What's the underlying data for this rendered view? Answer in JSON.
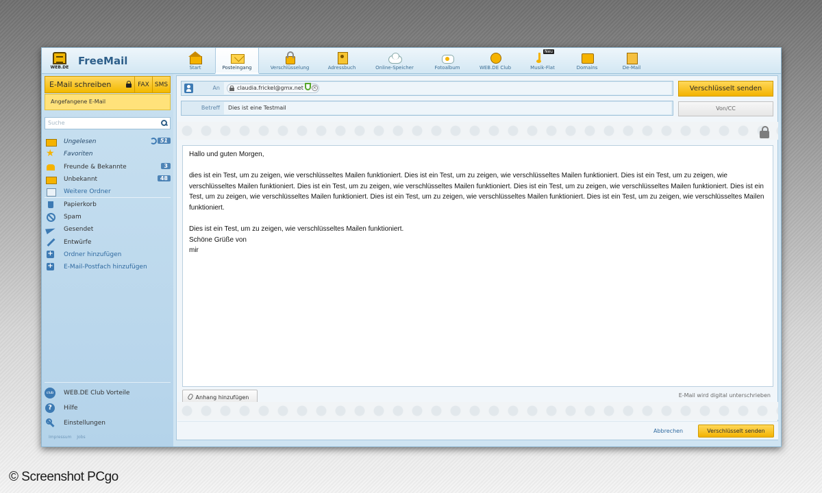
{
  "app": {
    "brand": "FreeMail",
    "logo_text": "WEB.DE"
  },
  "nav": [
    {
      "label": "Start",
      "icon": "home-icon"
    },
    {
      "label": "Posteingang",
      "icon": "mail-icon",
      "active": true
    },
    {
      "label": "Verschlüsselung",
      "icon": "lock-icon"
    },
    {
      "label": "Adressbuch",
      "icon": "addressbook-icon"
    },
    {
      "label": "Online-Speicher",
      "icon": "cloud-icon"
    },
    {
      "label": "Fotoalbum",
      "icon": "photo-icon"
    },
    {
      "label": "WEB.DE Club",
      "icon": "club-icon"
    },
    {
      "label": "Musik-Flat",
      "icon": "music-icon",
      "badge": "Neu"
    },
    {
      "label": "Domains",
      "icon": "domains-icon"
    },
    {
      "label": "De-Mail",
      "icon": "demail-icon"
    }
  ],
  "sidebar": {
    "compose_label": "E-Mail schreiben",
    "fax_label": "FAX",
    "sms_label": "SMS",
    "drafts_label": "Angefangene E-Mail",
    "search_placeholder": "Suche",
    "folders": [
      {
        "label": "Ungelesen",
        "badge": "51",
        "icon": "mail-icon"
      },
      {
        "label": "Favoriten",
        "icon": "star-icon"
      },
      {
        "label": "Freunde & Bekannte",
        "badge": "3",
        "icon": "people-icon"
      },
      {
        "label": "Unbekannt",
        "badge": "48",
        "icon": "mail-icon"
      },
      {
        "label": "Weitere Ordner",
        "icon": "folder-icon"
      },
      {
        "label": "Papierkorb",
        "icon": "trash-icon"
      },
      {
        "label": "Spam",
        "icon": "spam-icon"
      },
      {
        "label": "Gesendet",
        "icon": "sent-icon"
      },
      {
        "label": "Entwürfe",
        "icon": "pen-icon"
      },
      {
        "label": "Ordner hinzufügen",
        "icon": "plus-icon"
      },
      {
        "label": "E-Mail-Postfach hinzufügen",
        "icon": "plus-icon"
      }
    ],
    "bottom": [
      {
        "label": "WEB.DE Club Vorteile",
        "icon": "club-icon"
      },
      {
        "label": "Hilfe",
        "icon": "help-icon"
      },
      {
        "label": "Einstellungen",
        "icon": "wrench-icon"
      }
    ],
    "footer_links": [
      "Impressum",
      "Jobs"
    ]
  },
  "compose": {
    "to_label": "An",
    "recipient": "claudia.frickel@gmx.net",
    "subject_label": "Betreff",
    "subject": "Dies ist eine Testmail",
    "send_encrypted_label": "Verschlüsselt senden",
    "von_cc_label": "Von/CC",
    "body": {
      "greeting": "Hallo und guten Morgen,",
      "paragraph": "dies ist ein Test, um zu zeigen, wie verschlüsseltes Mailen funktioniert. Dies ist ein Test, um zu zeigen, wie verschlüsseltes Mailen funktioniert. Dies ist ein Test, um zu zeigen, wie verschlüsseltes Mailen funktioniert. Dies ist ein Test, um zu zeigen, wie verschlüsseltes Mailen funktioniert. Dies ist ein Test, um zu zeigen, wie verschlüsseltes Mailen funktioniert. Dies ist ein Test, um zu zeigen, wie verschlüsseltes Mailen funktioniert. Dies ist ein Test, um zu zeigen, wie verschlüsseltes Mailen funktioniert. Dies ist ein Test, um zu zeigen, wie verschlüsseltes Mailen funktioniert.",
      "line1": "Dies ist ein Test, um zu zeigen, wie verschlüsseltes Mailen funktioniert.",
      "line2": "Schöne Grüße von",
      "line3": "mir"
    },
    "attach_label": "Anhang hinzufügen",
    "sign_note": "E-Mail wird digital unterschrieben",
    "cancel_label": "Abbrechen",
    "send_bottom_label": "Verschlüsselt senden"
  },
  "watermark": "© Screenshot PCgo",
  "colors": {
    "accent": "#f3b900",
    "sidebar_bg": "#c8e0f0",
    "link": "#2f6aa0"
  }
}
